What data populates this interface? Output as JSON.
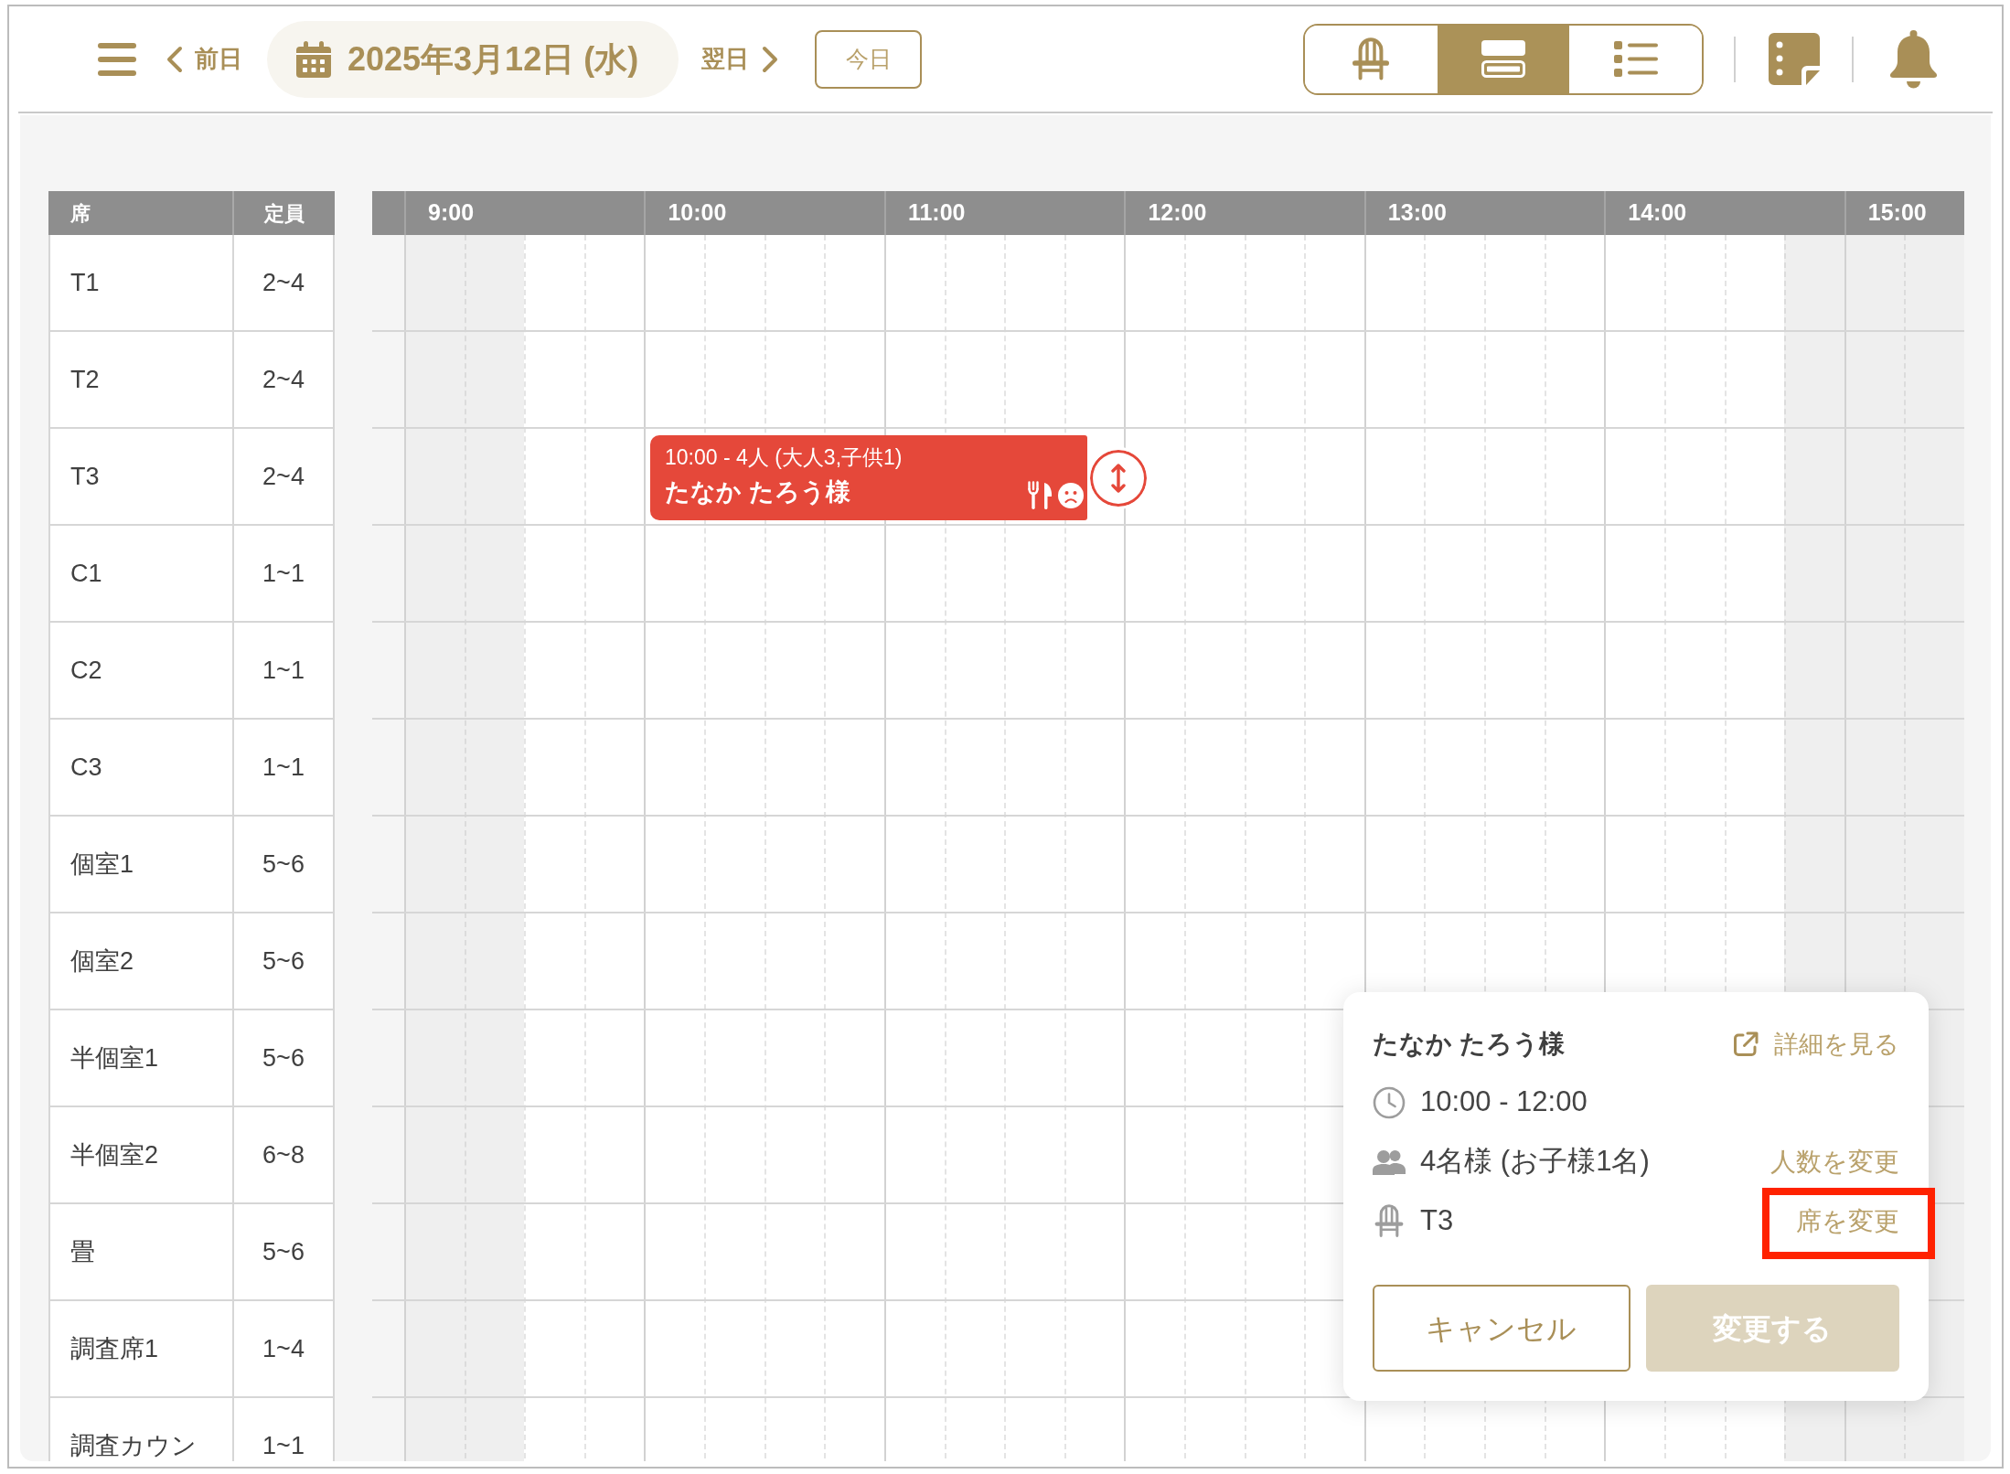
{
  "header": {
    "prev_label": "前日",
    "date": "2025年3月12日 (水)",
    "next_label": "翌日",
    "today_label": "今日",
    "views": [
      {
        "kind": "seat",
        "selected": false
      },
      {
        "kind": "timeline",
        "selected": true
      },
      {
        "kind": "list",
        "selected": false
      }
    ]
  },
  "seat_table": {
    "columns": [
      "席",
      "定員"
    ],
    "seats": [
      {
        "name": "T1",
        "capacity": "2~4"
      },
      {
        "name": "T2",
        "capacity": "2~4"
      },
      {
        "name": "T3",
        "capacity": "2~4",
        "reservation": {
          "summary": "10:00 - 4人 (大人3,子供1)",
          "guest": "たなか たろう様",
          "selected": true
        }
      },
      {
        "name": "C1",
        "capacity": "1~1"
      },
      {
        "name": "C2",
        "capacity": "1~1"
      },
      {
        "name": "C3",
        "capacity": "1~1"
      },
      {
        "name": "個室1",
        "capacity": "5~6"
      },
      {
        "name": "個室2",
        "capacity": "5~6"
      },
      {
        "name": "半個室1",
        "capacity": "5~6"
      },
      {
        "name": "半個室2",
        "capacity": "6~8"
      },
      {
        "name": "畳",
        "capacity": "5~6"
      },
      {
        "name": "調査席1",
        "capacity": "1~4"
      },
      {
        "name": "調査カウン",
        "capacity": "1~1"
      }
    ]
  },
  "timeline": {
    "hours": [
      {
        "label": "9:00",
        "quarters": [
          {
            "closed": true
          },
          {
            "closed": true
          },
          {
            "closed": false
          },
          {
            "closed": false
          }
        ]
      },
      {
        "label": "10:00",
        "quarters": [
          {
            "closed": false
          },
          {
            "closed": false
          },
          {
            "closed": false
          },
          {
            "closed": false
          }
        ]
      },
      {
        "label": "11:00",
        "quarters": [
          {
            "closed": false
          },
          {
            "closed": false
          },
          {
            "closed": false
          },
          {
            "closed": false
          }
        ]
      },
      {
        "label": "12:00",
        "quarters": [
          {
            "closed": false
          },
          {
            "closed": false
          },
          {
            "closed": false
          },
          {
            "closed": false
          }
        ]
      },
      {
        "label": "13:00",
        "quarters": [
          {
            "closed": false
          },
          {
            "closed": false
          },
          {
            "closed": false
          },
          {
            "closed": false
          }
        ]
      },
      {
        "label": "14:00",
        "quarters": [
          {
            "closed": false
          },
          {
            "closed": false
          },
          {
            "closed": false
          },
          {
            "closed": true
          }
        ]
      },
      {
        "label": "15:00",
        "quarters": [
          {
            "closed": true
          },
          {
            "closed": true
          }
        ]
      }
    ]
  },
  "popup": {
    "title": "たなか たろう様",
    "detail_link": "詳細を見る",
    "rows": [
      {
        "kind": "time",
        "text": "10:00 - 12:00"
      },
      {
        "kind": "people",
        "text": "4名様 (お子様1名)",
        "action": {
          "label": "人数を変更",
          "highlighted": false
        }
      },
      {
        "kind": "seat",
        "text": "T3",
        "action": {
          "label": "席を変更",
          "highlighted": true
        }
      }
    ],
    "buttons": [
      {
        "kind": "cancel",
        "label": "キャンセル",
        "disabled": false
      },
      {
        "kind": "confirm",
        "label": "変更する",
        "disabled": true
      }
    ]
  }
}
